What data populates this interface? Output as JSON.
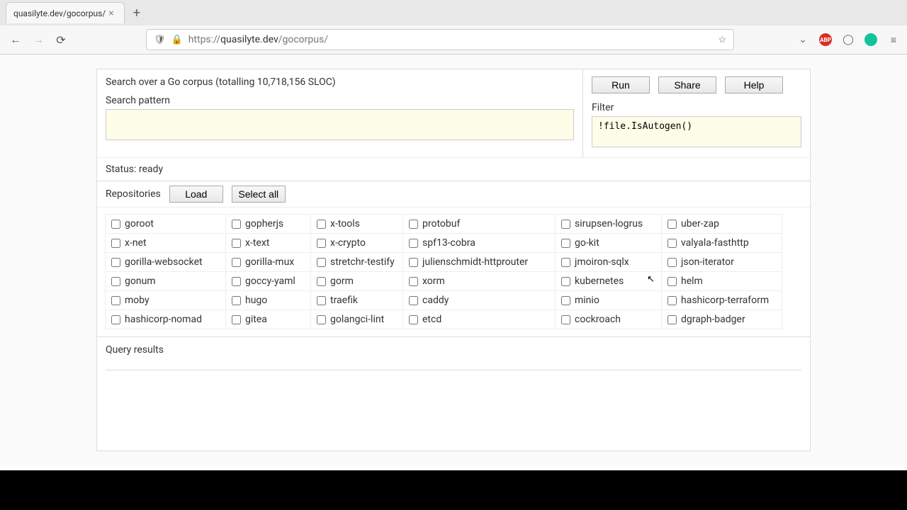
{
  "browser": {
    "tab_title": "quasilyte.dev/gocorpus/",
    "url_display_prefix": "https://",
    "url_display_host": "quasilyte.dev",
    "url_display_path": "/gocorpus/"
  },
  "header": {
    "corpus_line": "Search over a Go corpus (totalling 10,718,156 SLOC)",
    "search_pattern_label": "Search pattern",
    "filter_label": "Filter",
    "search_pattern_value": "",
    "filter_value": "!file.IsAutogen()"
  },
  "buttons": {
    "run": "Run",
    "share": "Share",
    "help": "Help",
    "load": "Load",
    "select_all": "Select all"
  },
  "status": "Status: ready",
  "repositories_label": "Repositories",
  "repos": [
    "goroot",
    "gopherjs",
    "x-tools",
    "protobuf",
    "sirupsen-logrus",
    "uber-zap",
    "x-net",
    "x-text",
    "x-crypto",
    "spf13-cobra",
    "go-kit",
    "valyala-fasthttp",
    "gorilla-websocket",
    "gorilla-mux",
    "stretchr-testify",
    "julienschmidt-httprouter",
    "jmoiron-sqlx",
    "json-iterator",
    "gonum",
    "goccy-yaml",
    "gorm",
    "xorm",
    "kubernetes",
    "helm",
    "moby",
    "hugo",
    "traefik",
    "caddy",
    "minio",
    "hashicorp-terraform",
    "hashicorp-nomad",
    "gitea",
    "golangci-lint",
    "etcd",
    "cockroach",
    "dgraph-badger"
  ],
  "query_results_label": "Query results"
}
